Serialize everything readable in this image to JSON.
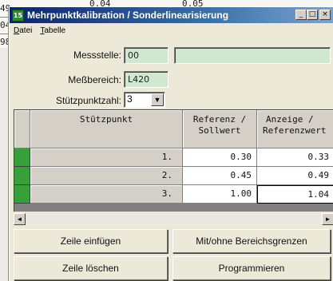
{
  "background_window": {
    "values": [
      "0.04",
      "0.05"
    ],
    "row_numbers": [
      "49",
      "04",
      "98"
    ]
  },
  "titlebar": {
    "icon_text": "15",
    "title": "Mehrpunktkalibration / Sonderlinearisierung",
    "minimize": "_",
    "maximize": "□",
    "close": "×"
  },
  "menu": {
    "items": [
      {
        "underline": "D",
        "rest": "atei"
      },
      {
        "underline": "T",
        "rest": "abelle"
      }
    ]
  },
  "form": {
    "messstelle_label": "Messstelle:",
    "messstelle_value": "00",
    "messstelle_name": "",
    "messbereich_label": "Meßbereich:",
    "messbereich_value": "L420",
    "stuetzpunktzahl_label": "Stützpunktzahl:",
    "stuetzpunktzahl_value": "3",
    "dropdown_arrow": "▼"
  },
  "table": {
    "headers": {
      "stuetzpunkt": "Stützpunkt",
      "referenz_line1": "Referenz /",
      "referenz_line2": "Sollwert",
      "anzeige_line1": "Anzeige /",
      "anzeige_line2": "Referenzwert"
    },
    "rows": [
      {
        "label": "1.",
        "referenz": "0.30",
        "anzeige": "0.33"
      },
      {
        "label": "2.",
        "referenz": "0.45",
        "anzeige": "0.49"
      },
      {
        "label": "3.",
        "referenz": "1.00",
        "anzeige": "1.04"
      }
    ]
  },
  "scrollbar": {
    "left": "◄",
    "right": "►"
  },
  "buttons": {
    "insert_row": "Zeile einfügen",
    "delete_row": "Zeile löschen",
    "range_limits": "Mit/ohne Bereichsgrenzen",
    "program": "Programmieren"
  },
  "colors": {
    "title_gradient_start": "#0a246a",
    "field_fill": "#d0e8d0",
    "row_marker": "#38a03a"
  }
}
